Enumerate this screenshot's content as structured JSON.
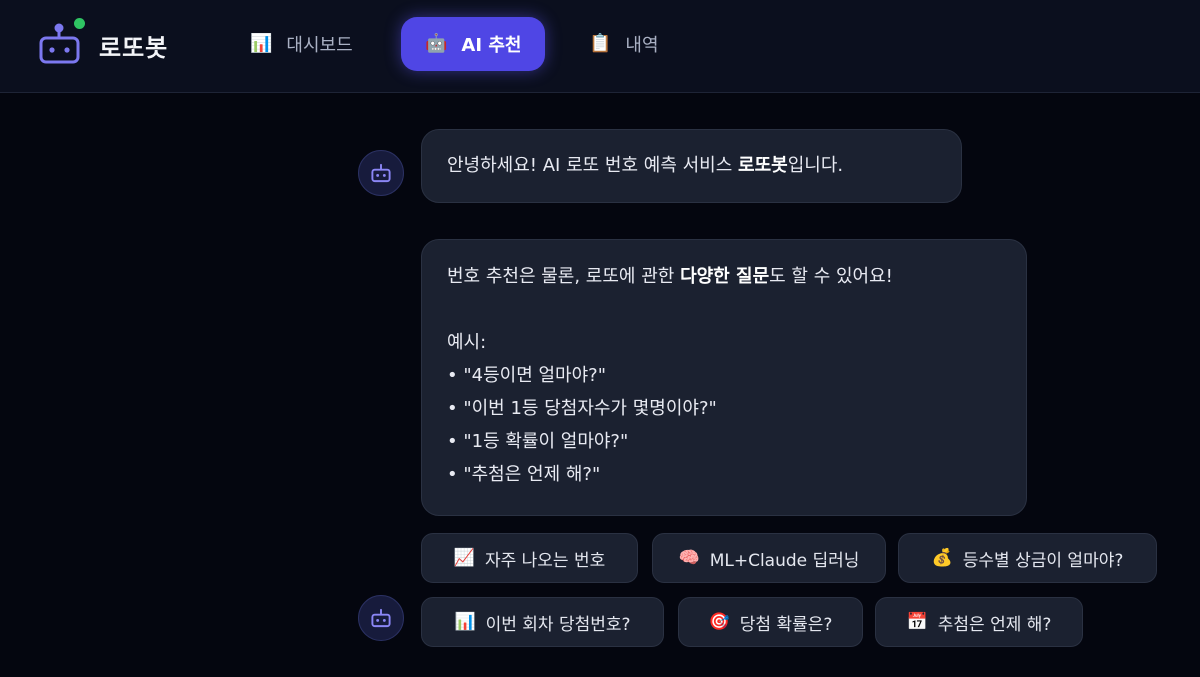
{
  "app": {
    "brand": "로또봇"
  },
  "nav": {
    "tabs": [
      {
        "label": "대시보드",
        "icon": "📊"
      },
      {
        "label": "AI 추천",
        "icon": "🤖"
      },
      {
        "label": "내역",
        "icon": "📋"
      }
    ]
  },
  "chat": {
    "greeting": {
      "prefix": "안녕하세요! AI 로또 번호 예측 서비스 ",
      "bold": "로또봇",
      "suffix": "입니다."
    },
    "intro": {
      "prefix": "번호 추천은 물론, 로또에 관한 ",
      "bold": "다양한 질문",
      "suffix": "도 할 수 있어요!",
      "examples_title": "예시:",
      "examples": [
        "• \"4등이면 얼마야?\"",
        "• \"이번 1등 당첨자수가 몇명이야?\"",
        "• \"1등 확률이 얼마야?\"",
        "• \"추첨은 언제 해?\""
      ]
    },
    "suggestions": [
      {
        "icon": "📈",
        "label": "자주 나오는 번호"
      },
      {
        "icon": "🧠",
        "label": "ML+Claude 딥러닝"
      },
      {
        "icon": "💰",
        "label": "등수별 상금이 얼마야?"
      },
      {
        "icon": "📊",
        "label": "이번 회차 당첨번호?"
      },
      {
        "icon": "🎯",
        "label": "당첨 확률은?"
      },
      {
        "icon": "📅",
        "label": "추첨은 언제 해?"
      }
    ]
  },
  "colors": {
    "accent": "#4f46e5",
    "background": "#04060f",
    "header": "#0b0f1e",
    "bubble": "#1b2130",
    "online": "#2fc463"
  }
}
